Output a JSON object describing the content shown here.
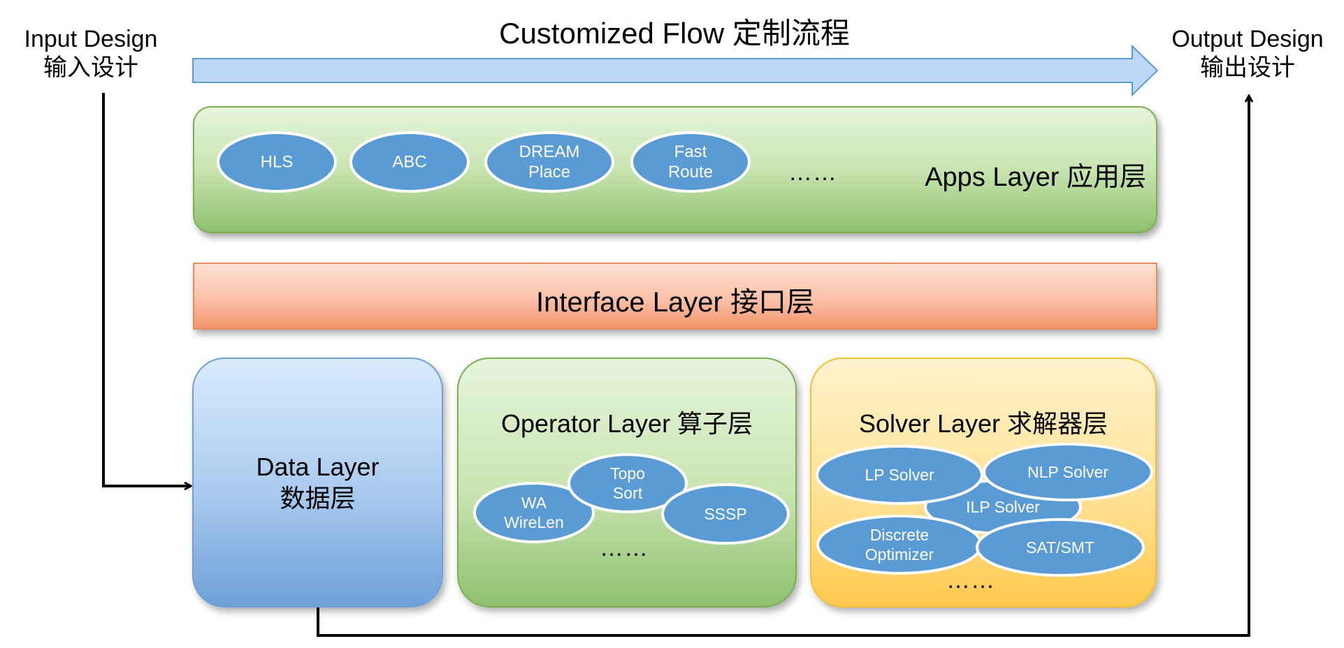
{
  "flow": {
    "title": "Customized Flow 定制流程",
    "input_line1": "Input Design",
    "input_line2": "输入设计",
    "output_line1": "Output Design",
    "output_line2": "输出设计"
  },
  "apps_layer": {
    "title": "Apps Layer 应用层",
    "apps": [
      {
        "label": "HLS"
      },
      {
        "label": "ABC"
      },
      {
        "label": "DREAM\nPlace"
      },
      {
        "label": "Fast\nRoute"
      }
    ],
    "more": "……"
  },
  "interface_layer": {
    "title": "Interface Layer 接口层"
  },
  "data_layer": {
    "line1": "Data Layer",
    "line2": "数据层"
  },
  "operator_layer": {
    "title": "Operator Layer 算子层",
    "operators": [
      {
        "label": "WA\nWireLen"
      },
      {
        "label": "Topo\nSort"
      },
      {
        "label": "SSSP"
      }
    ],
    "more": "……"
  },
  "solver_layer": {
    "title": "Solver Layer 求解器层",
    "solvers": [
      {
        "label": "ILP Solver"
      },
      {
        "label": "NLP Solver"
      },
      {
        "label": "LP Solver"
      },
      {
        "label": "Discrete\nOptimizer"
      },
      {
        "label": "SAT/SMT"
      }
    ],
    "more": "……"
  },
  "colors": {
    "node_fill": "#5b9bd5",
    "node_stroke": "#ffffff",
    "arrow_fill": "#bcd6f5",
    "arrow_stroke": "#5b9bd5"
  }
}
